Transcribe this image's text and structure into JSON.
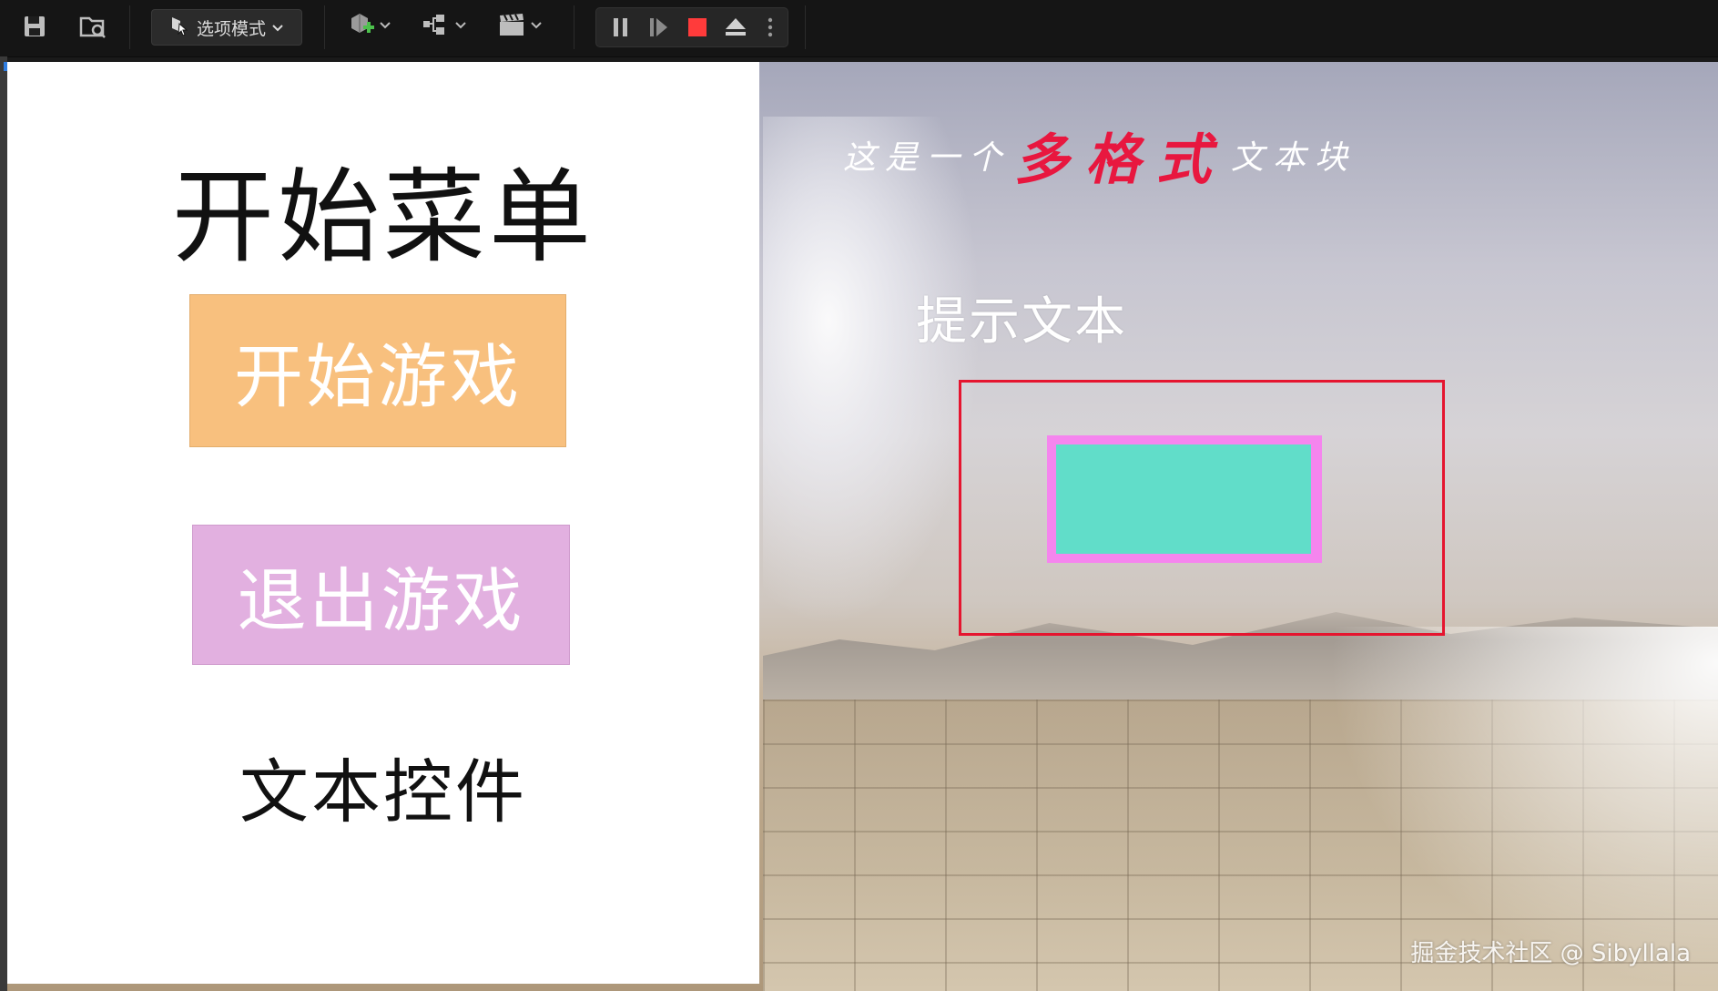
{
  "toolbar": {
    "mode_label": "选项模式",
    "icons": [
      "save-icon",
      "browse-icon",
      "select-mode-icon",
      "add-actor-icon",
      "blueprint-icon",
      "cinematics-icon",
      "pause-icon",
      "step-icon",
      "stop-icon",
      "eject-icon",
      "more-icon"
    ],
    "colors": {
      "stop": "#ff3b3b",
      "background": "#151515"
    }
  },
  "menu": {
    "title": "开始菜单",
    "start_button": "开始游戏",
    "quit_button": "退出游戏",
    "text_widget": "文本控件"
  },
  "overlay": {
    "rich_text_prefix": "这是一个",
    "rich_text_highlight": "多格式",
    "rich_text_suffix": "文本块",
    "hint_text": "提示文本",
    "watermark": "掘金技术社区 @ Sibyllala"
  },
  "colors": {
    "start_button_bg": "#f8c07e",
    "quit_button_bg": "#e2b0e0",
    "highlight_text": "#e8173f",
    "frame_border": "#e5152f",
    "teal_fill": "#61ddc9",
    "pink_border": "#f585ee"
  }
}
